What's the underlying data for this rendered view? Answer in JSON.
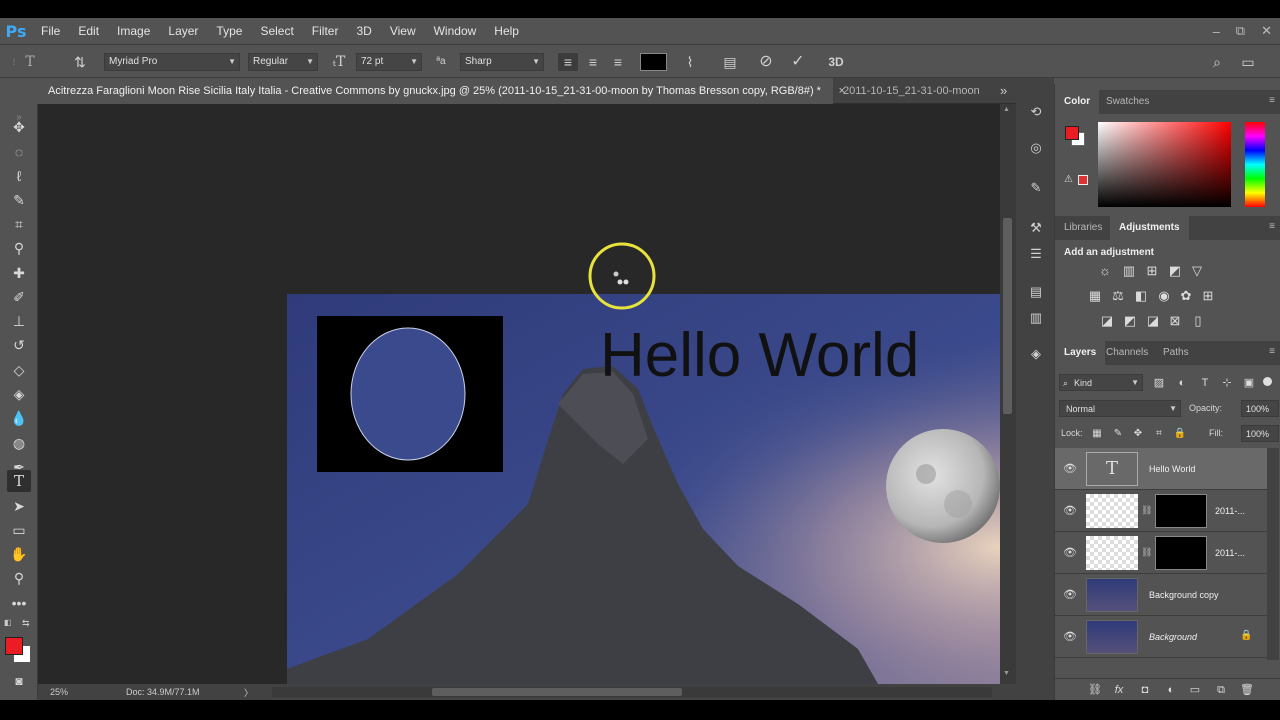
{
  "app": {
    "logo": "Ps"
  },
  "menu": [
    "File",
    "Edit",
    "Image",
    "Layer",
    "Type",
    "Select",
    "Filter",
    "3D",
    "View",
    "Window",
    "Help"
  ],
  "window_controls": {
    "minimize": "–",
    "restore": "⧉",
    "close": "✕"
  },
  "options_bar": {
    "font_family": "Myriad Pro",
    "font_style": "Regular",
    "font_size": "72 pt",
    "anti_alias_icon": "ªa",
    "anti_alias": "Sharp",
    "text_color": "#000000",
    "threed_label": "3D"
  },
  "tabs": [
    {
      "label": "Acitrezza Faraglioni Moon Rise Sicilia Italy Italia - Creative Commons by gnuckx.jpg @ 25% (2011-10-15_21-31-00-moon by Thomas Bresson copy, RGB/8#) *",
      "close": "×"
    },
    {
      "label": "2011-10-15_21-31-00-moon",
      "more": "»"
    }
  ],
  "canvas": {
    "text_layer": "Hello World"
  },
  "status": {
    "zoom": "25%",
    "doc": "Doc: 34.9M/77.1M",
    "arrow": "〉"
  },
  "color_panel": {
    "tabs": [
      "Color",
      "Swatches"
    ],
    "foreground": "#ec1c24",
    "background": "#ffffff"
  },
  "adjustments_panel": {
    "tabs": [
      "Libraries",
      "Adjustments"
    ],
    "heading": "Add an adjustment"
  },
  "layers_panel": {
    "tabs": [
      "Layers",
      "Channels",
      "Paths"
    ],
    "filter": "Kind",
    "blend_mode": "Normal",
    "opacity_label": "Opacity:",
    "opacity": "100%",
    "lock_label": "Lock:",
    "fill_label": "Fill:",
    "fill": "100%",
    "layers": [
      {
        "name": "Hello World"
      },
      {
        "name": "2011-..."
      },
      {
        "name": "2011-..."
      },
      {
        "name": "Background copy"
      },
      {
        "name": "Background"
      }
    ],
    "footer_fx": "fx"
  }
}
